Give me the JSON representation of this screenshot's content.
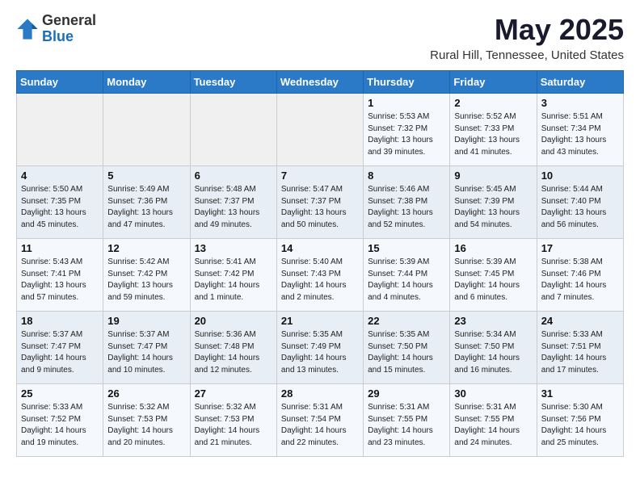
{
  "header": {
    "logo_line1": "General",
    "logo_line2": "Blue",
    "title": "May 2025",
    "subtitle": "Rural Hill, Tennessee, United States"
  },
  "weekdays": [
    "Sunday",
    "Monday",
    "Tuesday",
    "Wednesday",
    "Thursday",
    "Friday",
    "Saturday"
  ],
  "weeks": [
    [
      {
        "day": "",
        "info": ""
      },
      {
        "day": "",
        "info": ""
      },
      {
        "day": "",
        "info": ""
      },
      {
        "day": "",
        "info": ""
      },
      {
        "day": "1",
        "info": "Sunrise: 5:53 AM\nSunset: 7:32 PM\nDaylight: 13 hours\nand 39 minutes."
      },
      {
        "day": "2",
        "info": "Sunrise: 5:52 AM\nSunset: 7:33 PM\nDaylight: 13 hours\nand 41 minutes."
      },
      {
        "day": "3",
        "info": "Sunrise: 5:51 AM\nSunset: 7:34 PM\nDaylight: 13 hours\nand 43 minutes."
      }
    ],
    [
      {
        "day": "4",
        "info": "Sunrise: 5:50 AM\nSunset: 7:35 PM\nDaylight: 13 hours\nand 45 minutes."
      },
      {
        "day": "5",
        "info": "Sunrise: 5:49 AM\nSunset: 7:36 PM\nDaylight: 13 hours\nand 47 minutes."
      },
      {
        "day": "6",
        "info": "Sunrise: 5:48 AM\nSunset: 7:37 PM\nDaylight: 13 hours\nand 49 minutes."
      },
      {
        "day": "7",
        "info": "Sunrise: 5:47 AM\nSunset: 7:37 PM\nDaylight: 13 hours\nand 50 minutes."
      },
      {
        "day": "8",
        "info": "Sunrise: 5:46 AM\nSunset: 7:38 PM\nDaylight: 13 hours\nand 52 minutes."
      },
      {
        "day": "9",
        "info": "Sunrise: 5:45 AM\nSunset: 7:39 PM\nDaylight: 13 hours\nand 54 minutes."
      },
      {
        "day": "10",
        "info": "Sunrise: 5:44 AM\nSunset: 7:40 PM\nDaylight: 13 hours\nand 56 minutes."
      }
    ],
    [
      {
        "day": "11",
        "info": "Sunrise: 5:43 AM\nSunset: 7:41 PM\nDaylight: 13 hours\nand 57 minutes."
      },
      {
        "day": "12",
        "info": "Sunrise: 5:42 AM\nSunset: 7:42 PM\nDaylight: 13 hours\nand 59 minutes."
      },
      {
        "day": "13",
        "info": "Sunrise: 5:41 AM\nSunset: 7:42 PM\nDaylight: 14 hours\nand 1 minute."
      },
      {
        "day": "14",
        "info": "Sunrise: 5:40 AM\nSunset: 7:43 PM\nDaylight: 14 hours\nand 2 minutes."
      },
      {
        "day": "15",
        "info": "Sunrise: 5:39 AM\nSunset: 7:44 PM\nDaylight: 14 hours\nand 4 minutes."
      },
      {
        "day": "16",
        "info": "Sunrise: 5:39 AM\nSunset: 7:45 PM\nDaylight: 14 hours\nand 6 minutes."
      },
      {
        "day": "17",
        "info": "Sunrise: 5:38 AM\nSunset: 7:46 PM\nDaylight: 14 hours\nand 7 minutes."
      }
    ],
    [
      {
        "day": "18",
        "info": "Sunrise: 5:37 AM\nSunset: 7:47 PM\nDaylight: 14 hours\nand 9 minutes."
      },
      {
        "day": "19",
        "info": "Sunrise: 5:37 AM\nSunset: 7:47 PM\nDaylight: 14 hours\nand 10 minutes."
      },
      {
        "day": "20",
        "info": "Sunrise: 5:36 AM\nSunset: 7:48 PM\nDaylight: 14 hours\nand 12 minutes."
      },
      {
        "day": "21",
        "info": "Sunrise: 5:35 AM\nSunset: 7:49 PM\nDaylight: 14 hours\nand 13 minutes."
      },
      {
        "day": "22",
        "info": "Sunrise: 5:35 AM\nSunset: 7:50 PM\nDaylight: 14 hours\nand 15 minutes."
      },
      {
        "day": "23",
        "info": "Sunrise: 5:34 AM\nSunset: 7:50 PM\nDaylight: 14 hours\nand 16 minutes."
      },
      {
        "day": "24",
        "info": "Sunrise: 5:33 AM\nSunset: 7:51 PM\nDaylight: 14 hours\nand 17 minutes."
      }
    ],
    [
      {
        "day": "25",
        "info": "Sunrise: 5:33 AM\nSunset: 7:52 PM\nDaylight: 14 hours\nand 19 minutes."
      },
      {
        "day": "26",
        "info": "Sunrise: 5:32 AM\nSunset: 7:53 PM\nDaylight: 14 hours\nand 20 minutes."
      },
      {
        "day": "27",
        "info": "Sunrise: 5:32 AM\nSunset: 7:53 PM\nDaylight: 14 hours\nand 21 minutes."
      },
      {
        "day": "28",
        "info": "Sunrise: 5:31 AM\nSunset: 7:54 PM\nDaylight: 14 hours\nand 22 minutes."
      },
      {
        "day": "29",
        "info": "Sunrise: 5:31 AM\nSunset: 7:55 PM\nDaylight: 14 hours\nand 23 minutes."
      },
      {
        "day": "30",
        "info": "Sunrise: 5:31 AM\nSunset: 7:55 PM\nDaylight: 14 hours\nand 24 minutes."
      },
      {
        "day": "31",
        "info": "Sunrise: 5:30 AM\nSunset: 7:56 PM\nDaylight: 14 hours\nand 25 minutes."
      }
    ]
  ]
}
